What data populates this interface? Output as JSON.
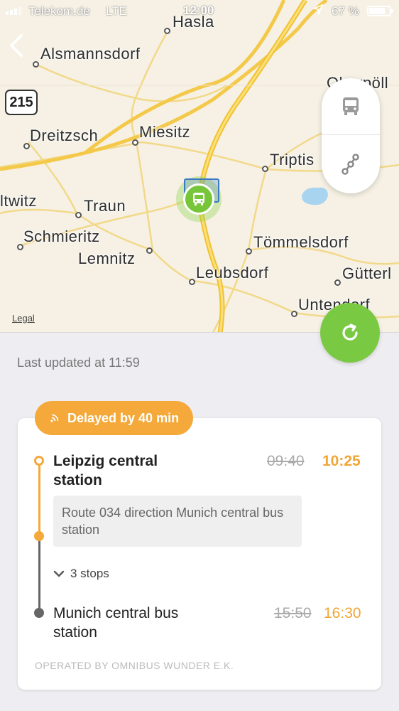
{
  "status_bar": {
    "carrier": "Telekom.de",
    "network": "LTE",
    "time": "12:00",
    "battery": "67 %"
  },
  "map": {
    "places": [
      "Hasla",
      "Alsmannsdorf",
      "Dreitzsch",
      "Miesitz",
      "Triptis",
      "ltwitz",
      "Traun",
      "Schmieritz",
      "Lemnitz",
      "Tömmelsdorf",
      "Leubsdorf",
      "Gütterl",
      "Untendorf",
      "Oberpöll"
    ],
    "road_shield": "215",
    "legal": "Legal",
    "icons": [
      "back-icon",
      "bus-icon",
      "route-icon",
      "refresh-icon"
    ]
  },
  "last_updated": "Last updated at 11:59",
  "trip": {
    "delay_badge": "Delayed by 40 min",
    "origin": {
      "name": "Leipzig central station",
      "scheduled": "09:40",
      "actual": "10:25"
    },
    "route_info": "Route 034 direction Munich central bus station",
    "stops_toggle": "3 stops",
    "destination": {
      "name": "Munich central bus station",
      "scheduled": "15:50",
      "actual": "16:30"
    },
    "operator": "OPERATED BY OMNIBUS WUNDER E.K."
  },
  "colors": {
    "accent_green": "#7ac943",
    "delay_orange": "#f4a93a"
  }
}
